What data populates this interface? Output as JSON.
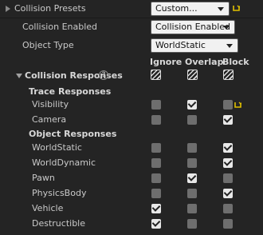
{
  "collision_presets": {
    "label": "Collision Presets",
    "value": "Custom..."
  },
  "collision_enabled": {
    "label": "Collision Enabled",
    "value": "Collision Enabled"
  },
  "object_type": {
    "label": "Object Type",
    "value": "WorldStatic"
  },
  "columns": {
    "ignore": "Ignore",
    "overlap": "Overlap",
    "block": "Block"
  },
  "collision_responses": {
    "label": "Collision Responses"
  },
  "trace_responses": {
    "heading": "Trace Responses",
    "items": [
      {
        "label": "Visibility",
        "ignore": false,
        "overlap": true,
        "block": false
      },
      {
        "label": "Camera",
        "ignore": false,
        "overlap": false,
        "block": true
      }
    ]
  },
  "object_responses": {
    "heading": "Object Responses",
    "items": [
      {
        "label": "WorldStatic",
        "ignore": false,
        "overlap": false,
        "block": true
      },
      {
        "label": "WorldDynamic",
        "ignore": false,
        "overlap": false,
        "block": true
      },
      {
        "label": "Pawn",
        "ignore": false,
        "overlap": true,
        "block": false
      },
      {
        "label": "PhysicsBody",
        "ignore": false,
        "overlap": false,
        "block": true
      },
      {
        "label": "Vehicle",
        "ignore": true,
        "overlap": false,
        "block": false
      },
      {
        "label": "Destructible",
        "ignore": true,
        "overlap": false,
        "block": false
      }
    ]
  },
  "colors": {
    "reset_arrow": "#e0c000",
    "panel": "#242424",
    "checkbox_on": "#e8e8e8",
    "checkbox_off": "#6e6e6e"
  }
}
